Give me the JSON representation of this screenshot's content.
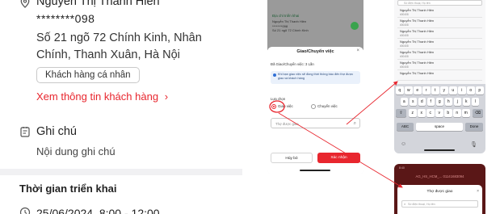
{
  "left": {
    "customer_name": "Nguyễn Thị Thanh Hiền",
    "phone": "********098",
    "address": "Số 21 ngõ 72 Chính Kinh, Nhân Chính, Thanh Xuân, Hà Nội",
    "customer_type": "Khách hàng cá nhân",
    "view_info_link": "Xem thông tin khách hàng",
    "link_chevron": "›",
    "note_title": "Ghi chú",
    "note_body": "Nội dung ghi chú",
    "time_title": "Thời gian triển khai",
    "time_value": "25/06/2024, 8:00 - 12:00"
  },
  "middle": {
    "address_section_label": "Địa chỉ triển khai",
    "contact_name": "Nguyễn Thị Thanh Hiền",
    "contact_phone": "********098",
    "contact_address": "Số 21 ngõ 72 Chính Kinh",
    "sheet_title": "Giao/Chuyển việc",
    "close_glyph": "×",
    "transfer_count": "Đã Giao/Chuyển việc: 3 Lần",
    "info_text": "Khi bạn giao việc sẽ đồng thời thông báo đến thợ được giao và khách hàng",
    "choose_label": "Lựa chọn",
    "option_assign": "Giao việc",
    "option_transfer": "Chuyển việc",
    "selected_option": "Giao việc",
    "assignee_placeholder": "Thợ được giao",
    "search_glyph": "⌕",
    "cancel_label": "Hủy bỏ",
    "confirm_label": "Xác nhận",
    "accent": "#e8262e"
  },
  "right_top": {
    "search_placeholder": "Số điện thoại, Họ tên",
    "results": [
      {
        "name": "Nguyễn Thị Thanh Hiền",
        "code": "#00408"
      },
      {
        "name": "Nguyễn Thị Thanh Hiền",
        "code": "#00408"
      },
      {
        "name": "Nguyễn Thị Thanh Hiền",
        "code": "#00408"
      },
      {
        "name": "Nguyễn Thị Thanh Hiền",
        "code": "#00408"
      },
      {
        "name": "Nguyễn Thị Thanh Hiền",
        "code": "#00408"
      },
      {
        "name": "Nguyễn Thị Thanh Hiền",
        "code": "#00408"
      },
      {
        "name": "Nguyễn Thị Thanh Hiền",
        "code": ""
      }
    ],
    "keyboard": {
      "row1": [
        "q",
        "w",
        "e",
        "r",
        "t",
        "y",
        "u",
        "i",
        "o",
        "p"
      ],
      "row2": [
        "a",
        "s",
        "d",
        "f",
        "g",
        "h",
        "j",
        "k",
        "l"
      ],
      "row3": [
        "z",
        "x",
        "c",
        "v",
        "b",
        "n",
        "m"
      ],
      "shift": "⇧",
      "backspace": "⌫",
      "abc": "ABC",
      "space": "space",
      "done": "Done",
      "emoji": "☺",
      "mic": "🎙"
    }
  },
  "right_bottom": {
    "status_time": "8:40",
    "header_text": "AG_HS_HCM_... 01141683094",
    "sheet_title": "Thợ được giao",
    "close_glyph": "×",
    "search_placeholder": "Số điện thoại, Họ tên",
    "search_glyph": "⌕"
  }
}
